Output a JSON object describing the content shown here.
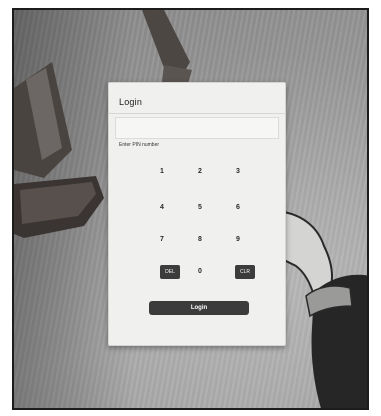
{
  "dialog": {
    "title": "Login",
    "pin_prompt": "Enter PIN number",
    "pin_value": ""
  },
  "keypad": {
    "rows": [
      [
        "1",
        "2",
        "3"
      ],
      [
        "4",
        "5",
        "6"
      ],
      [
        "7",
        "8",
        "9"
      ]
    ],
    "delete_label": "DEL",
    "zero_label": "0",
    "clear_label": "CLR"
  },
  "actions": {
    "login_label": "Login"
  },
  "colors": {
    "panel_background": "#f0f0ef",
    "button_dark": "#3c3c3c",
    "button_text": "#ffffff",
    "backdrop": "#9b9b9b"
  }
}
